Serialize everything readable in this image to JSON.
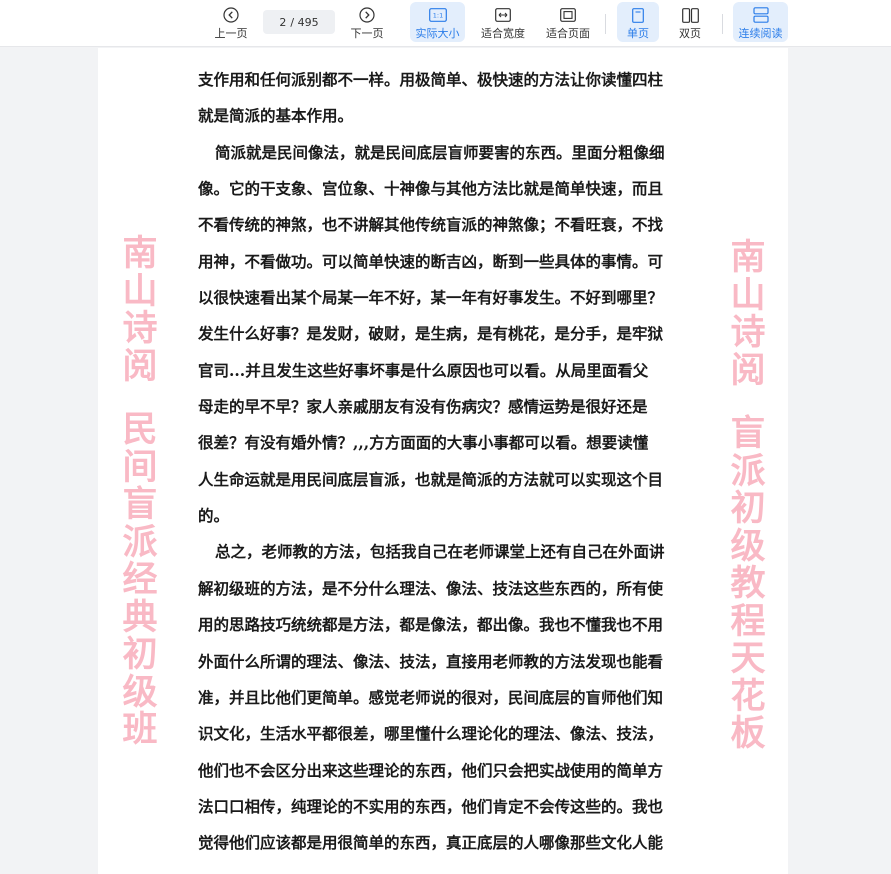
{
  "toolbar": {
    "prev_label": "上一页",
    "page_current": "2",
    "page_total": "/ 495",
    "next_label": "下一页",
    "actual_size_label": "实际大小",
    "actual_size_icon_text": "1:1",
    "fit_width_label": "适合宽度",
    "fit_page_label": "适合页面",
    "single_page_label": "单页",
    "double_page_label": "双页",
    "continuous_label": "连续阅读",
    "accent_color": "#2b7de9"
  },
  "document": {
    "lines": [
      "支作用和任何派别都不一样。用极简单、极快速的方法让你读懂四柱",
      "就是简派的基本作用。",
      "简派就是民间像法，就是民间底层盲师要害的东西。里面分粗像细",
      "像。它的干支象、宫位象、十神像与其他方法比就是简单快速，而且",
      "不看传统的神煞，也不讲解其他传统盲派的神煞像；不看旺衰，不找",
      "用神，不看做功。可以简单快速的断吉凶，断到一些具体的事情。可",
      "以很快速看出某个局某一年不好，某一年有好事发生。不好到哪里？",
      "发生什么好事？是发财，破财，是生病，是有桃花，是分手，是牢狱",
      "官司...并且发生这些好事坏事是什么原因也可以看。从局里面看父",
      "母走的早不早？家人亲戚朋友有没有伤病灾？感情运势是很好还是",
      "很差？有没有婚外情？,,,方方面面的大事小事都可以看。想要读懂",
      "人生命运就是用民间底层盲派，也就是简派的方法就可以实现这个目",
      "的。",
      "总之，老师教的方法，包括我自己在老师课堂上还有自己在外面讲",
      "解初级班的方法，是不分什么理法、像法、技法这些东西的，所有使",
      "用的思路技巧统统都是方法，都是像法，都出像。我也不懂我也不用",
      "外面什么所谓的理法、像法、技法，直接用老师教的方法发现也能看",
      "准，并且比他们更简单。感觉老师说的很对，民间底层的盲师他们知",
      "识文化，生活水平都很差，哪里懂什么理论化的理法、像法、技法，",
      "他们也不会区分出来这些理论的东西，他们只会把实战使用的简单方",
      "法口口相传，纯理论的不实用的东西，他们肯定不会传这些的。我也",
      "觉得他们应该都是用很简单的东西，真正底层的人哪像那些文化人能"
    ]
  },
  "watermark": {
    "left_part1": [
      "南",
      "山",
      "诗",
      "阅"
    ],
    "left_part2": [
      "民",
      "间",
      "盲",
      "派",
      "经",
      "典",
      "初",
      "级",
      "班"
    ],
    "right_part1": [
      "南",
      "山",
      "诗",
      "阅"
    ],
    "right_part2": [
      "盲",
      "派",
      "初",
      "级",
      "教",
      "程",
      "天",
      "花",
      "板"
    ],
    "color": "#f48096"
  }
}
